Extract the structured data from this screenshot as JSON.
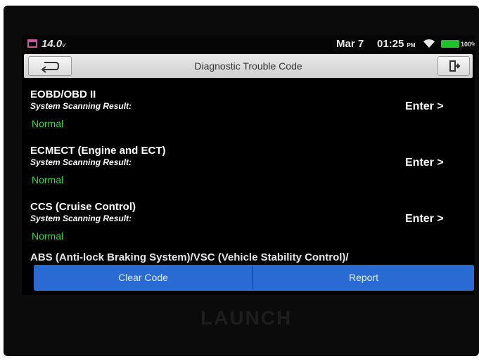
{
  "status_bar": {
    "voltage": "14.0",
    "voltage_unit": "v",
    "date": "Mar 7",
    "time": "01:25",
    "time_suffix": "PM",
    "battery": "100%"
  },
  "title_bar": {
    "title": "Diagnostic Trouble Code",
    "back_icon": "back-arrow-icon",
    "exit_icon": "exit-icon"
  },
  "systems": [
    {
      "name": "EOBD/OBD II",
      "label": "System Scanning Result:",
      "status": "Normal",
      "enter": "Enter >"
    },
    {
      "name": "ECMECT (Engine and ECT)",
      "label": "System Scanning Result:",
      "status": "Normal",
      "enter": "Enter >"
    },
    {
      "name": "CCS (Cruise Control)",
      "label": "System Scanning Result:",
      "status": "Normal",
      "enter": "Enter >"
    },
    {
      "name": "ABS (Anti-lock Braking System)/VSC (Vehicle Stability Control)/"
    }
  ],
  "actions": {
    "clear_code": "Clear Code",
    "report": "Report"
  },
  "device": {
    "brand": "LAUNCH"
  },
  "colors": {
    "normal_status": "#39d839",
    "action_bar": "#2a6bd3",
    "battery": "#20c22a"
  }
}
